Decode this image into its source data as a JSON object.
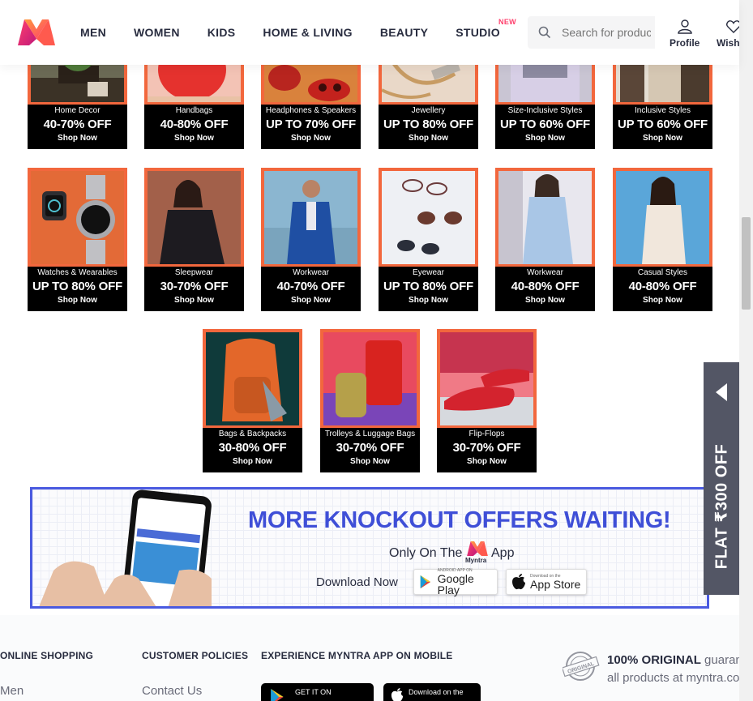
{
  "header": {
    "nav": [
      {
        "label": "MEN"
      },
      {
        "label": "WOMEN"
      },
      {
        "label": "KIDS"
      },
      {
        "label": "HOME & LIVING"
      },
      {
        "label": "BEAUTY"
      },
      {
        "label": "STUDIO",
        "badge": "NEW"
      }
    ],
    "search_placeholder": "Search for products, brands and more",
    "profile_label": "Profile",
    "wishlist_label": "Wishlist"
  },
  "tiles_row1": [
    {
      "category": "Home Decor",
      "offer": "40-70% OFF",
      "cta": "Shop Now"
    },
    {
      "category": "Handbags",
      "offer": "40-80% OFF",
      "cta": "Shop Now"
    },
    {
      "category": "Headphones & Speakers",
      "offer": "UP TO 70% OFF",
      "cta": "Shop Now"
    },
    {
      "category": "Jewellery",
      "offer": "UP TO 80% OFF",
      "cta": "Shop Now"
    },
    {
      "category": "Size-Inclusive Styles",
      "offer": "UP TO 60% OFF",
      "cta": "Shop Now"
    },
    {
      "category": "Inclusive Styles",
      "offer": "UP TO 60% OFF",
      "cta": "Shop Now"
    }
  ],
  "tiles_row2": [
    {
      "category": "Watches & Wearables",
      "offer": "UP TO 80% OFF",
      "cta": "Shop Now"
    },
    {
      "category": "Sleepwear",
      "offer": "30-70% OFF",
      "cta": "Shop Now"
    },
    {
      "category": "Workwear",
      "offer": "40-70% OFF",
      "cta": "Shop Now"
    },
    {
      "category": "Eyewear",
      "offer": "UP TO 80% OFF",
      "cta": "Shop Now"
    },
    {
      "category": "Workwear",
      "offer": "40-80% OFF",
      "cta": "Shop Now"
    },
    {
      "category": "Casual Styles",
      "offer": "40-80% OFF",
      "cta": "Shop Now"
    }
  ],
  "tiles_row3": [
    {
      "category": "Bags & Backpacks",
      "offer": "30-80% OFF",
      "cta": "Shop Now"
    },
    {
      "category": "Trolleys & Luggage Bags",
      "offer": "30-70% OFF",
      "cta": "Shop Now"
    },
    {
      "category": "Flip-Flops",
      "offer": "30-70% OFF",
      "cta": "Shop Now"
    }
  ],
  "banner": {
    "headline": "MORE KNOCKOUT OFFERS WAITING!",
    "only_on": "Only On The",
    "brand": "Myntra",
    "app": "App",
    "download": "Download Now",
    "google_small": "ANDROID APP ON",
    "google_big": "Google Play",
    "apple_small": "Download on the",
    "apple_big": "App Store"
  },
  "side_promo": {
    "text": "FLAT ₹300 OFF"
  },
  "footer": {
    "online_shopping": "ONLINE SHOPPING",
    "customer_policies": "CUSTOMER POLICIES",
    "experience_app": "EXPERIENCE MYNTRA APP ON MOBILE",
    "link_men": "Men",
    "link_contact": "Contact Us",
    "get_it_on": "GET IT ON",
    "download_on": "Download on the",
    "original_bold": "100% ORIGINAL",
    "original_rest": " guarantee for",
    "original_line2": "all products at myntra.com",
    "original_stamp": "ORIGINAL"
  },
  "colors": {
    "accent": "#ff3f6c",
    "tile_frame": "#f2673d",
    "banner_blue": "#3f4fd7",
    "promo_bg": "#535665"
  }
}
